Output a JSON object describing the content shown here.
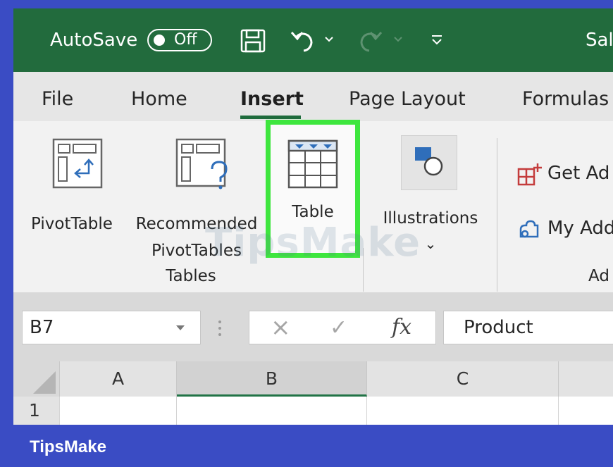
{
  "titlebar": {
    "autosave_label": "AutoSave",
    "autosave_state": "Off",
    "save_icon": "save-icon",
    "undo_icon": "undo-icon",
    "redo_icon": "redo-icon",
    "customize_icon": "customize-qat-icon",
    "file_name_partial": "Sal"
  },
  "tabs": [
    {
      "label": "File"
    },
    {
      "label": "Home"
    },
    {
      "label": "Insert",
      "active": true
    },
    {
      "label": "Page Layout"
    },
    {
      "label": "Formulas"
    }
  ],
  "ribbon": {
    "pivot_table": "PivotTable",
    "recommended_line1": "Recommended",
    "recommended_line2": "PivotTables",
    "table": "Table",
    "illustrations": "Illustrations",
    "illustrations_caret": "⌄",
    "get_addins": "Get Ad",
    "my_addins": "My Add",
    "group_tables": "Tables",
    "group_addins": "Ad"
  },
  "formula_bar": {
    "name_box": "B7",
    "cancel_icon": "×",
    "enter_icon": "✓",
    "fx": "fx",
    "content": "Product"
  },
  "grid": {
    "columns": [
      "A",
      "B",
      "C"
    ],
    "row1": "1"
  },
  "watermark": "TipsMake",
  "footer": {
    "brand": "TipsMake"
  },
  "colors": {
    "title_green": "#226b3d",
    "highlight_green": "#3ee63e",
    "frame_blue": "#3a4cc4",
    "addin_red": "#c43c3c"
  }
}
